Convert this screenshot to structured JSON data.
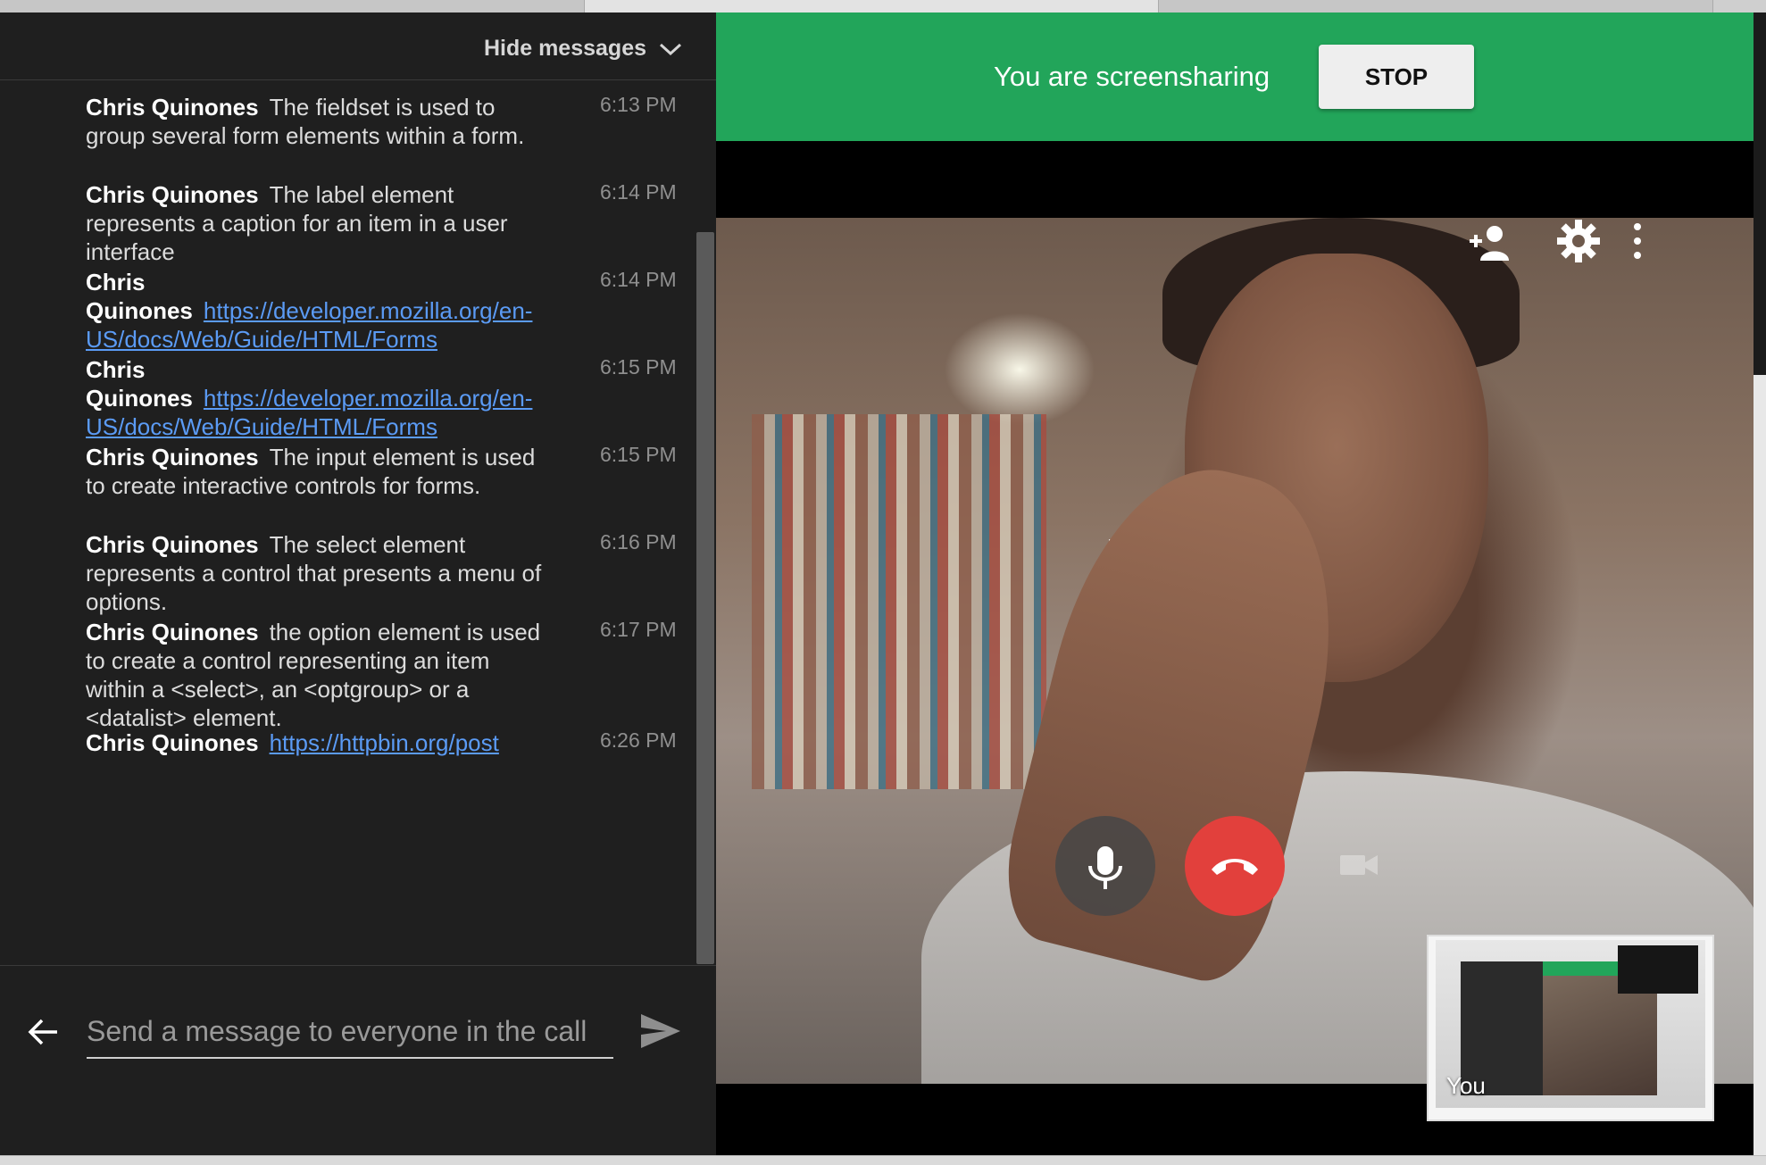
{
  "chat": {
    "hide_label": "Hide messages",
    "messages": [
      {
        "sender": "Chris Quinones",
        "text": "The fieldset is used to group several form elements within a form.",
        "time": "6:13 PM"
      },
      {
        "sender": "Chris Quinones",
        "text": "The label element represents a caption for an item in a user interface",
        "time": "6:14 PM"
      },
      {
        "sender": "Chris Quinones",
        "link": "https://developer.mozilla.org/en-US/docs/Web/Guide/HTML/Forms",
        "time": "6:14 PM"
      },
      {
        "sender": "Chris Quinones",
        "link": "https://developer.mozilla.org/en-US/docs/Web/Guide/HTML/Forms",
        "time": "6:15 PM"
      },
      {
        "sender": "Chris Quinones",
        "text": "The  input element is used to create interactive controls for forms.",
        "time": "6:15 PM"
      },
      {
        "sender": "Chris Quinones",
        "text": "The select element represents a control that presents a menu of options.",
        "time": "6:16 PM"
      },
      {
        "sender": "Chris Quinones",
        "text": "the option element is used to create a control representing an item within a <select>, an <optgroup> or a <datalist> element.",
        "time": "6:17 PM"
      },
      {
        "sender": "Chris Quinones",
        "link": "https://httpbin.org/post",
        "time": "6:26 PM"
      }
    ],
    "input_placeholder": "Send a message to everyone in the call",
    "input_value": ""
  },
  "call": {
    "banner_text": "You are screensharing",
    "stop_label": "STOP",
    "self_label": "You"
  },
  "icons": {
    "collapse": "chevron-down-icon",
    "back": "arrow-left-icon",
    "send": "send-icon",
    "add_person": "person-add-icon",
    "settings": "gear-icon",
    "more": "more-vert-icon",
    "mic": "microphone-icon",
    "hangup": "hang-up-icon",
    "camera": "camera-icon"
  },
  "colors": {
    "banner": "#22a55a",
    "hangup": "#e2403c",
    "link": "#5b9bf5",
    "panel": "#1f1f1f"
  }
}
